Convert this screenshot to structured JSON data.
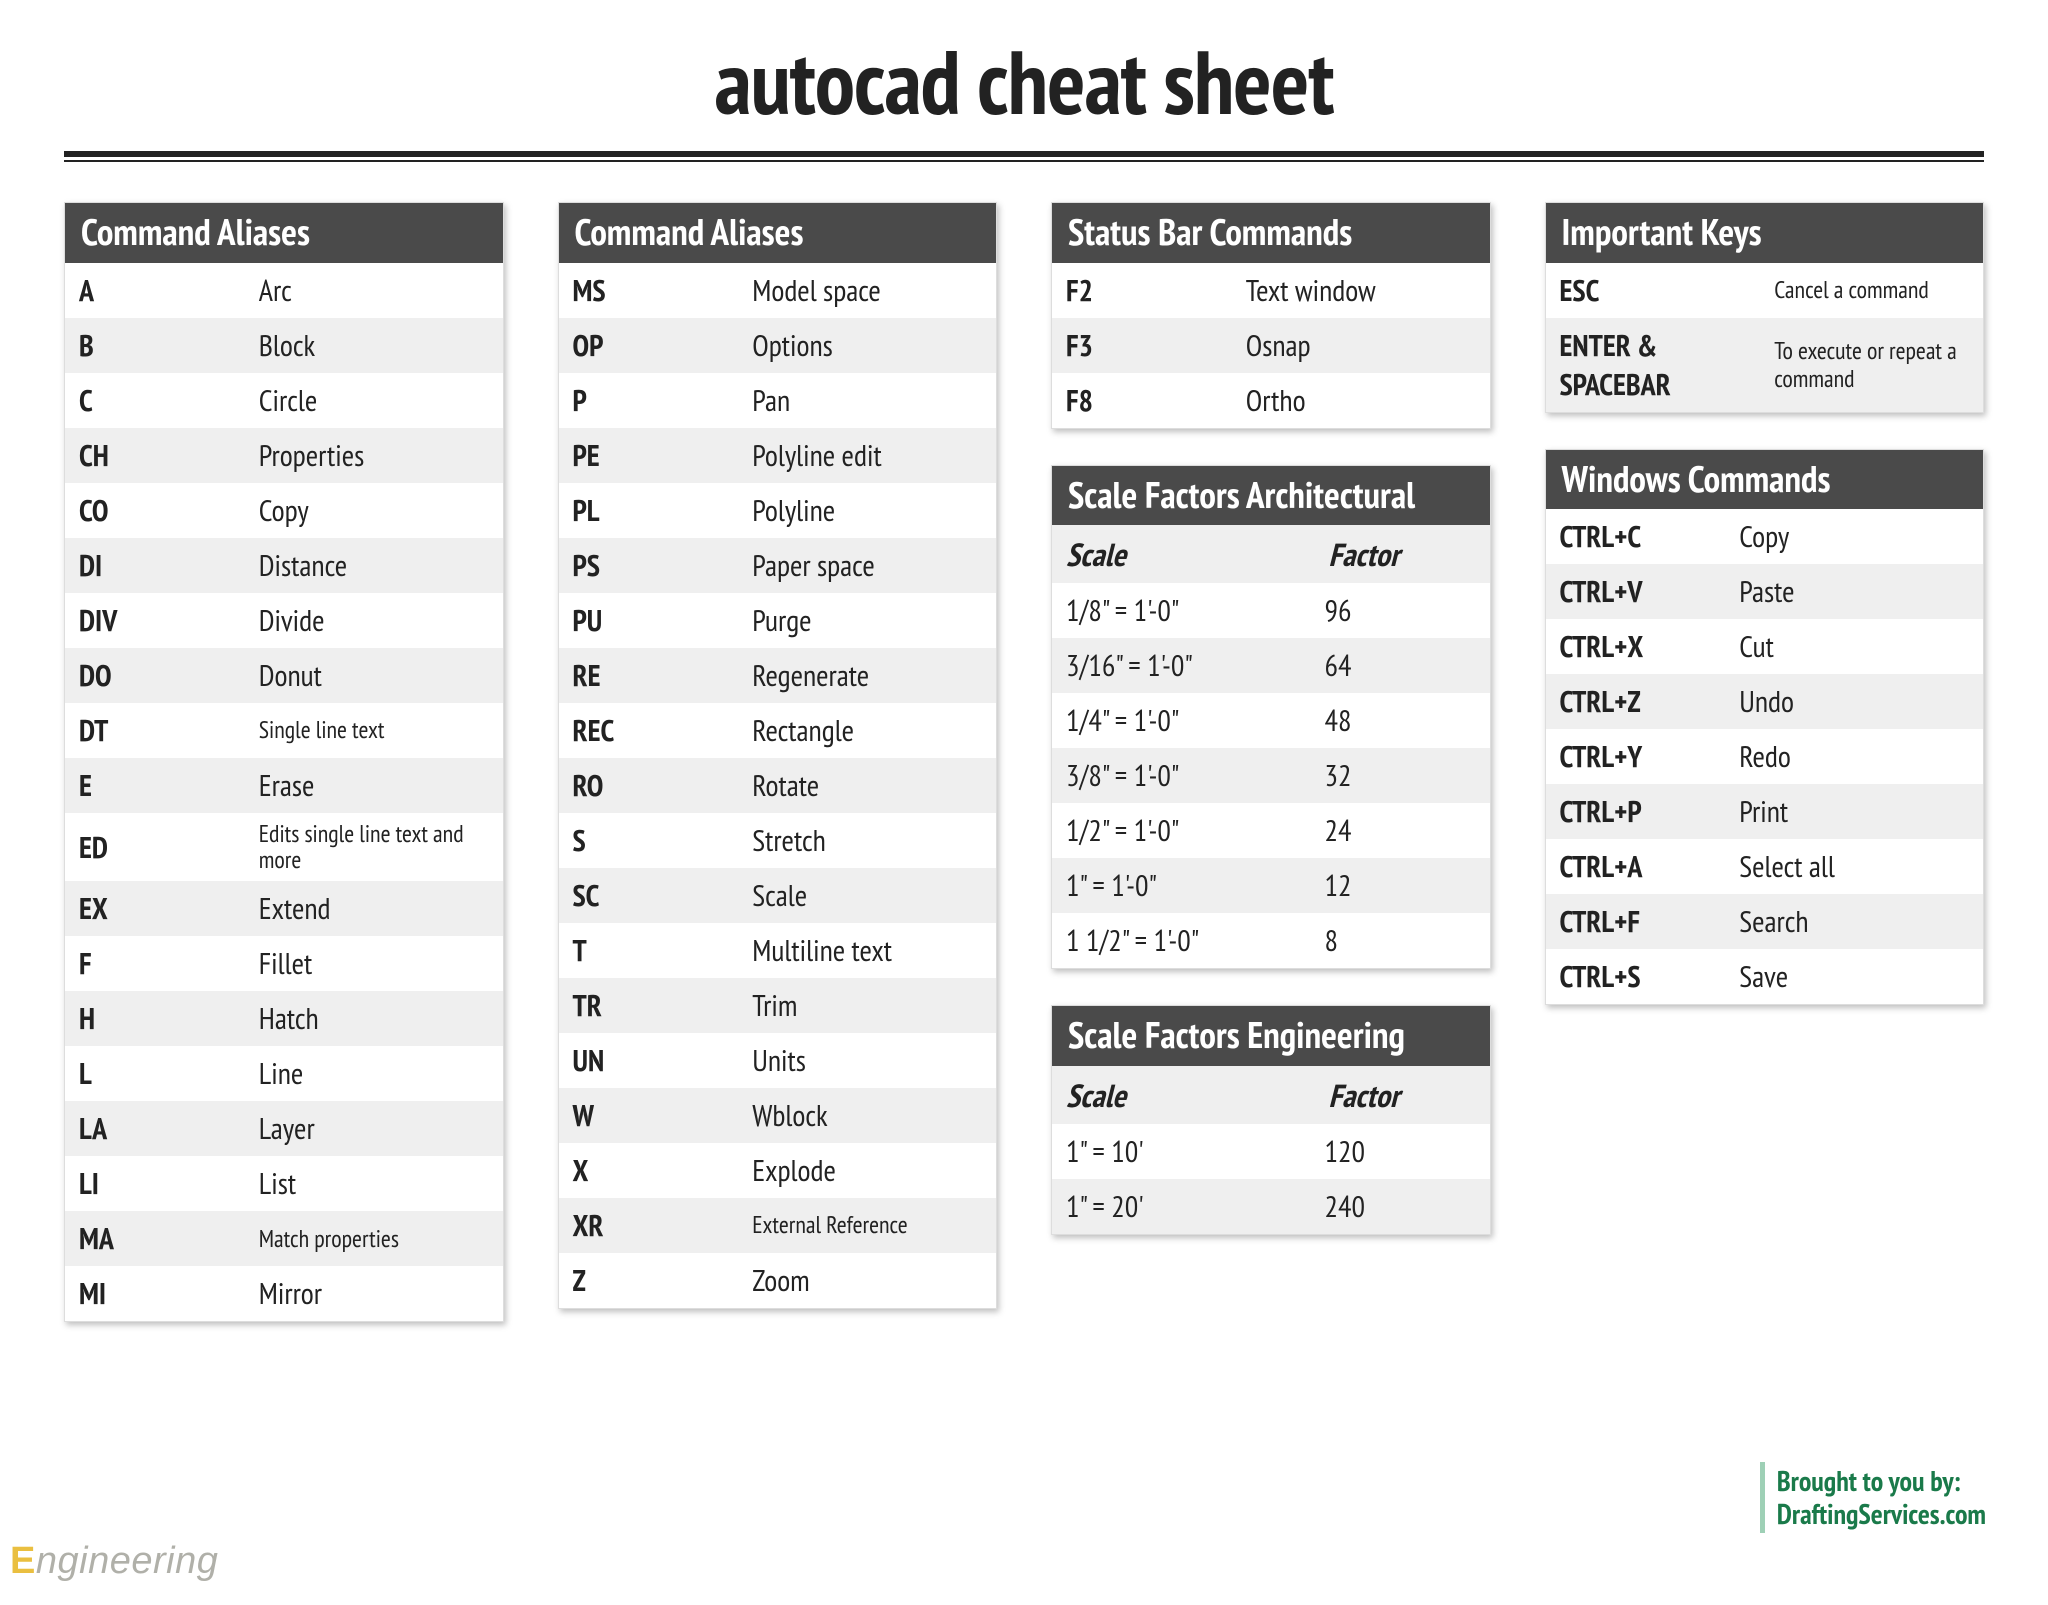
{
  "title": "autocad cheat sheet",
  "credit_line1": "Brought to you by:",
  "credit_line2": "DraftingServices.com",
  "watermark_accent": "E",
  "watermark_rest": "ngineering",
  "cards": {
    "aliases1": {
      "header": "Command Aliases",
      "rows": [
        {
          "c1": "A",
          "c2": "Arc"
        },
        {
          "c1": "B",
          "c2": "Block"
        },
        {
          "c1": "C",
          "c2": "Circle"
        },
        {
          "c1": "CH",
          "c2": "Properties"
        },
        {
          "c1": "CO",
          "c2": "Copy"
        },
        {
          "c1": "DI",
          "c2": "Distance"
        },
        {
          "c1": "DIV",
          "c2": "Divide"
        },
        {
          "c1": "DO",
          "c2": "Donut"
        },
        {
          "c1": "DT",
          "c2": "Single line text",
          "sm": true
        },
        {
          "c1": "E",
          "c2": "Erase"
        },
        {
          "c1": "ED",
          "c2": "Edits single line text and more",
          "sm": true
        },
        {
          "c1": "EX",
          "c2": "Extend"
        },
        {
          "c1": "F",
          "c2": "Fillet"
        },
        {
          "c1": "H",
          "c2": "Hatch"
        },
        {
          "c1": "L",
          "c2": "Line"
        },
        {
          "c1": "LA",
          "c2": "Layer"
        },
        {
          "c1": "LI",
          "c2": "List"
        },
        {
          "c1": "MA",
          "c2": "Match properties",
          "sm": true
        },
        {
          "c1": "MI",
          "c2": "Mirror"
        }
      ]
    },
    "aliases2": {
      "header": "Command Aliases",
      "rows": [
        {
          "c1": "MS",
          "c2": "Model space"
        },
        {
          "c1": "OP",
          "c2": "Options"
        },
        {
          "c1": "P",
          "c2": "Pan"
        },
        {
          "c1": "PE",
          "c2": "Polyline edit"
        },
        {
          "c1": "PL",
          "c2": "Polyline"
        },
        {
          "c1": "PS",
          "c2": "Paper space"
        },
        {
          "c1": "PU",
          "c2": "Purge"
        },
        {
          "c1": "RE",
          "c2": "Regenerate"
        },
        {
          "c1": "REC",
          "c2": "Rectangle"
        },
        {
          "c1": "RO",
          "c2": "Rotate"
        },
        {
          "c1": "S",
          "c2": "Stretch"
        },
        {
          "c1": "SC",
          "c2": "Scale"
        },
        {
          "c1": "T",
          "c2": "Multiline text"
        },
        {
          "c1": "TR",
          "c2": "Trim"
        },
        {
          "c1": "UN",
          "c2": "Units"
        },
        {
          "c1": "W",
          "c2": "Wblock"
        },
        {
          "c1": "X",
          "c2": "Explode"
        },
        {
          "c1": "XR",
          "c2": "External Reference",
          "sm": true
        },
        {
          "c1": "Z",
          "c2": "Zoom"
        }
      ]
    },
    "status": {
      "header": "Status Bar Commands",
      "rows": [
        {
          "c1": "F2",
          "c2": "Text window"
        },
        {
          "c1": "F3",
          "c2": "Osnap"
        },
        {
          "c1": "F8",
          "c2": "Ortho"
        }
      ]
    },
    "scale_arch": {
      "header": "Scale Factors Architectural",
      "sub": {
        "c1": "Scale",
        "c2": "Factor"
      },
      "rows": [
        {
          "c1": "1/8\" = 1'-0\"",
          "c2": "96"
        },
        {
          "c1": "3/16\" = 1'-0\"",
          "c2": "64"
        },
        {
          "c1": "1/4\" = 1'-0\"",
          "c2": "48"
        },
        {
          "c1": "3/8\" = 1'-0\"",
          "c2": "32"
        },
        {
          "c1": "1/2\" = 1'-0\"",
          "c2": "24"
        },
        {
          "c1": "1\" = 1'-0\"",
          "c2": "12"
        },
        {
          "c1": "1 1/2\" = 1'-0\"",
          "c2": "8"
        }
      ]
    },
    "scale_eng": {
      "header": "Scale Factors Engineering",
      "sub": {
        "c1": "Scale",
        "c2": "Factor"
      },
      "rows": [
        {
          "c1": "1\" = 10'",
          "c2": "120"
        },
        {
          "c1": "1\" = 20'",
          "c2": "240"
        }
      ]
    },
    "important": {
      "header": "Important Keys",
      "rows": [
        {
          "c1": "ESC",
          "c2": "Cancel a command"
        },
        {
          "c1": "ENTER & SPACEBAR",
          "c2": "To execute or repeat a command"
        }
      ]
    },
    "windows": {
      "header": "Windows Commands",
      "rows": [
        {
          "c1": "CTRL+C",
          "c2": "Copy"
        },
        {
          "c1": "CTRL+V",
          "c2": "Paste"
        },
        {
          "c1": "CTRL+X",
          "c2": "Cut"
        },
        {
          "c1": "CTRL+Z",
          "c2": "Undo"
        },
        {
          "c1": "CTRL+Y",
          "c2": "Redo"
        },
        {
          "c1": "CTRL+P",
          "c2": "Print"
        },
        {
          "c1": "CTRL+A",
          "c2": "Select all"
        },
        {
          "c1": "CTRL+F",
          "c2": "Search"
        },
        {
          "c1": "CTRL+S",
          "c2": "Save"
        }
      ]
    }
  }
}
